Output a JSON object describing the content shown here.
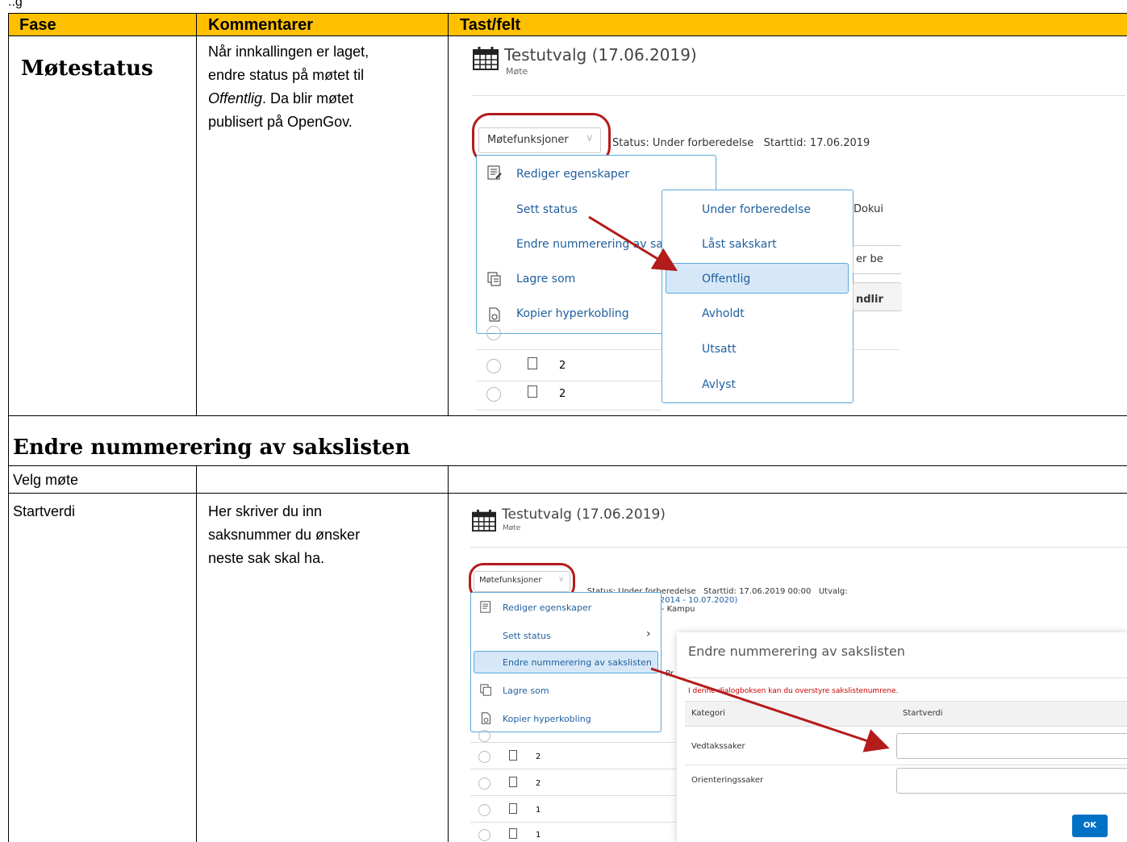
{
  "top_fragment": "..g",
  "header": {
    "col1": "Fase",
    "col2": "Kommentarer",
    "col3": "Tast/felt"
  },
  "row1": {
    "fase": "Møtestatus",
    "kommentar_a": "Når innkallingen er laget,",
    "kommentar_b": "endre status på møtet til",
    "kommentar_c_italic": "Offentlig",
    "kommentar_c_rest": ". Da blir møtet",
    "kommentar_d": "publisert på OpenGov.",
    "shot": {
      "title": "Testutvalg (17.06.2019)",
      "subtitle": "Møte",
      "button": "Møtefunksjoner",
      "status_line": "Status: Under forberedelse   Starttid: 17.06.2019",
      "menu": [
        "Rediger egenskaper",
        "Sett status",
        "Endre nummerering av sak",
        "Lagre som",
        "Kopier hyperkobling"
      ],
      "submenu": [
        "Under forberedelse",
        "Låst sakskart",
        "Offentlig",
        "Avholdt",
        "Utsatt",
        "Avlyst"
      ],
      "right_fragments": [
        "Dokui",
        "er be",
        "ndlir"
      ],
      "row_numbers": [
        "2",
        "2"
      ]
    }
  },
  "section_title": "Endre nummerering av sakslisten",
  "row2": {
    "fase": "Velg møte"
  },
  "row3": {
    "fase": "Startverdi",
    "kommentar_a": "Her skriver du inn",
    "kommentar_b": "saksnummer du ønsker",
    "kommentar_c": "neste sak skal ha.",
    "shot": {
      "title": "Testutvalg (17.06.2019)",
      "subtitle": "Møte",
      "button": "Møtefunksjoner",
      "status_prefix": "Status: Under forberedelse   Starttid: 17.06.2019 00:00   Utvalg:",
      "status_link": "Testutvalg (10.07.2014 - 10.07.2020)",
      "status_suffix": "Møtested: A7-001 - Kampu",
      "menu": [
        "Rediger egenskaper",
        "Sett status",
        "Endre nummerering av sakslisten",
        "Lagre som",
        "Kopier hyperkobling"
      ],
      "submenu_chevron": "›",
      "dialog_title": "Endre nummerering av sakslisten",
      "dialog_info": "I denne dialogboksen kan du overstyre sakslistenumrene.",
      "col_kategori": "Kategori",
      "col_startverdi": "Startverdi",
      "rows": [
        "Vedtakssaker",
        "Orienteringssaker"
      ],
      "ok": "OK",
      "row_numbers": [
        "2",
        "2",
        "1",
        "1"
      ],
      "fragment": "Pr"
    }
  },
  "colors": {
    "header": "#ffc000",
    "link": "#1f5f9e",
    "highlight": "#d6e8f7",
    "arrow": "#b41b1b",
    "ok_button": "#0072c6"
  }
}
